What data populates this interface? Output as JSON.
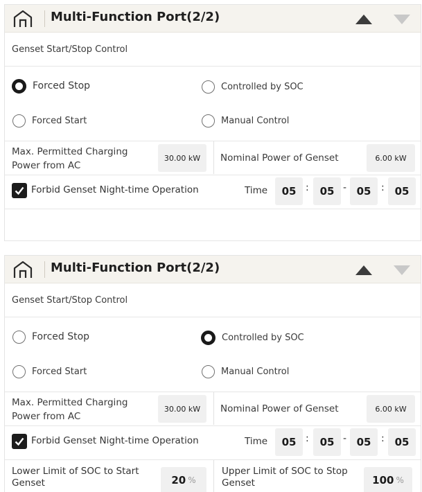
{
  "panels": [
    {
      "title": "Multi-Function Port(2/2)",
      "section": "Genset Start/Stop Control",
      "selected": "forced_stop",
      "options": {
        "forced_stop": "Forced Stop",
        "controlled_by_soc": "Controlled by SOC",
        "forced_start": "Forced Start",
        "manual_control": "Manual Control"
      },
      "charging_label": "Max. Permitted Charging Power from AC",
      "charging_value": "30.00 kW",
      "genset_label": "Nominal Power of Genset",
      "genset_value": "6.00 kW",
      "forbid_label": "Forbid Genset Night-time Operation",
      "forbid_checked": true,
      "time_label": "Time",
      "time": [
        "05",
        "05",
        "05",
        "05"
      ],
      "time_separators": [
        ":",
        "-",
        ":"
      ]
    },
    {
      "title": "Multi-Function Port(2/2)",
      "section": "Genset Start/Stop Control",
      "selected": "controlled_by_soc",
      "options": {
        "forced_stop": "Forced Stop",
        "controlled_by_soc": "Controlled by SOC",
        "forced_start": "Forced Start",
        "manual_control": "Manual Control"
      },
      "charging_label": "Max. Permitted Charging Power from AC",
      "charging_value": "30.00 kW",
      "genset_label": "Nominal Power of Genset",
      "genset_value": "6.00 kW",
      "forbid_label": "Forbid Genset Night-time Operation",
      "forbid_checked": true,
      "time_label": "Time",
      "time": [
        "05",
        "05",
        "05",
        "05"
      ],
      "time_separators": [
        ":",
        "-",
        ":"
      ],
      "soc_lower_label": "Lower Limit of SOC to Start Genset",
      "soc_lower_value": "20",
      "soc_upper_label": "Upper Limit of SOC to Stop Genset",
      "soc_upper_value": "100",
      "soc_unit": "%"
    }
  ],
  "icons": {
    "home": "home-icon",
    "up": "triangle-up-icon",
    "down": "triangle-down-icon",
    "check": "checkmark-icon"
  },
  "colors": {
    "header_bg": "#f5f3ee",
    "arrow_active": "#3c3c3c",
    "arrow_inactive": "#c8c8c8",
    "field_bg": "#f0f0f0"
  }
}
